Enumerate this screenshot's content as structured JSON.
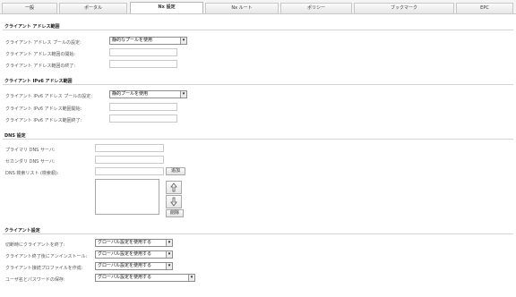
{
  "tabs": [
    {
      "label": "一般"
    },
    {
      "label": "ポータル"
    },
    {
      "label": "Nx 設定"
    },
    {
      "label": "Nx ルート"
    },
    {
      "label": "ポリシー"
    },
    {
      "label": "ブックマーク"
    },
    {
      "label": "EPC"
    }
  ],
  "client_address": {
    "title": "クライアント アドレス範囲",
    "pool_setting_label": "クライアント アドレス プールの設定:",
    "pool_setting_value": "静的なプールを使用",
    "range_start_label": "クライアント アドレス範囲の開始:",
    "range_end_label": "クライアント アドレス範囲の終了:"
  },
  "client_ipv6": {
    "title": "クライアント IPv6 アドレス範囲",
    "pool_setting_label": "クライアント IPv6 アドレス プールの設定:",
    "pool_setting_value": "静的プールを使用",
    "range_start_label": "クライアント IPv6 アドレス範囲開始:",
    "range_end_label": "クライアント IPv6 アドレス範囲終了:"
  },
  "dns": {
    "title": "DNS 設定",
    "primary_label": "プライマリ DNS サーバ:",
    "secondary_label": "セカンダリ DNS サーバ:",
    "search_list_label": "DNS 検索リスト (検索順):",
    "add_button": "追加",
    "delete_button": "削除"
  },
  "client_settings": {
    "title": "クライアント設定",
    "rows": [
      {
        "label": "切断時にクライアントを終了:",
        "value": "グローバル設定を使用する"
      },
      {
        "label": "クライアント終了後にアンインストール:",
        "value": "グローバル設定を使用する"
      },
      {
        "label": "クライアント接続プロファイルを作成:",
        "value": "グローバル設定を使用する"
      },
      {
        "label": "ユーザ名とパスワードの保存:",
        "value": "グローバル設定を使用する"
      }
    ]
  }
}
